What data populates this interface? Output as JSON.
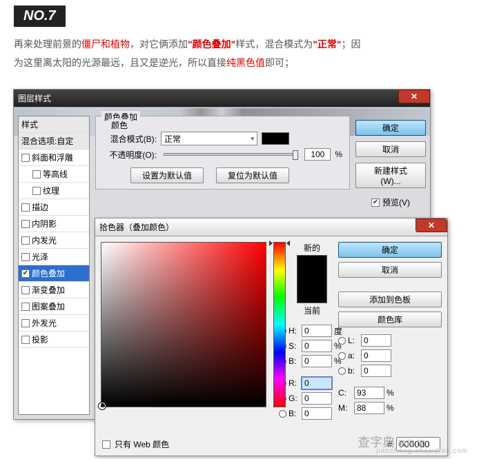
{
  "header": {
    "badge": "NO.7"
  },
  "paragraph": {
    "p1a": "再来处理前景的",
    "p1b": "僵尸和植物",
    "p1c": "，对它俩添加",
    "p1d": "\"颜色叠加\"",
    "p1e": "样式，混合模式为",
    "p1f": "\"正常\"",
    "p1g": "；因",
    "p2a": "为这里离太阳的光源最远，且又是逆光，所以直接",
    "p2b": "纯黑色值",
    "p2c": "即可；"
  },
  "layerStyle": {
    "title": "图层样式",
    "styles_header": "样式",
    "blend_options": "混合选项:自定",
    "items": [
      {
        "label": "斜面和浮雕",
        "checked": false
      },
      {
        "label": "等高线",
        "checked": false,
        "indent": true
      },
      {
        "label": "纹理",
        "checked": false,
        "indent": true
      },
      {
        "label": "描边",
        "checked": false
      },
      {
        "label": "内阴影",
        "checked": false
      },
      {
        "label": "内发光",
        "checked": false
      },
      {
        "label": "光泽",
        "checked": false
      },
      {
        "label": "颜色叠加",
        "checked": true,
        "selected": true
      },
      {
        "label": "渐变叠加",
        "checked": false
      },
      {
        "label": "图案叠加",
        "checked": false
      },
      {
        "label": "外发光",
        "checked": false
      },
      {
        "label": "投影",
        "checked": false
      }
    ],
    "group_title": "颜色叠加",
    "sub_group_title": "颜色",
    "blend_mode_label": "混合模式(B):",
    "blend_mode_value": "正常",
    "opacity_label": "不透明度(O):",
    "opacity_value": "100",
    "opacity_unit": "%",
    "default_btn": "设置为默认值",
    "reset_btn": "复位为默认值",
    "ok": "确定",
    "cancel": "取消",
    "new_style": "新建样式(W)...",
    "preview": "预览(V)"
  },
  "picker": {
    "title": "拾色器（叠加颜色）",
    "new_label": "新的",
    "current_label": "当前",
    "ok": "确定",
    "cancel": "取消",
    "add_swatch": "添加到色板",
    "color_lib": "颜色库",
    "web_only": "只有 Web 颜色",
    "hex_prefix": "#",
    "hex": "000000",
    "hsb": {
      "h": "0",
      "s": "0",
      "b": "0"
    },
    "lab": {
      "l": "0",
      "a": "0",
      "b": "0"
    },
    "rgb": {
      "r": "0",
      "g": "0",
      "b": "0"
    },
    "cmyk": {
      "c": "93",
      "m": "88"
    },
    "units": {
      "deg": "度",
      "pct": "%"
    },
    "labels": {
      "H": "H:",
      "S": "S:",
      "B": "B:",
      "L": "L:",
      "a": "a:",
      "b": "b:",
      "R": "R:",
      "G": "G:",
      "Bch": "B:",
      "C": "C:",
      "M": "M:"
    }
  },
  "watermark": {
    "main": "查字典",
    "sub": "教程 网",
    "url": "jiaocheng.chazidian.com"
  }
}
